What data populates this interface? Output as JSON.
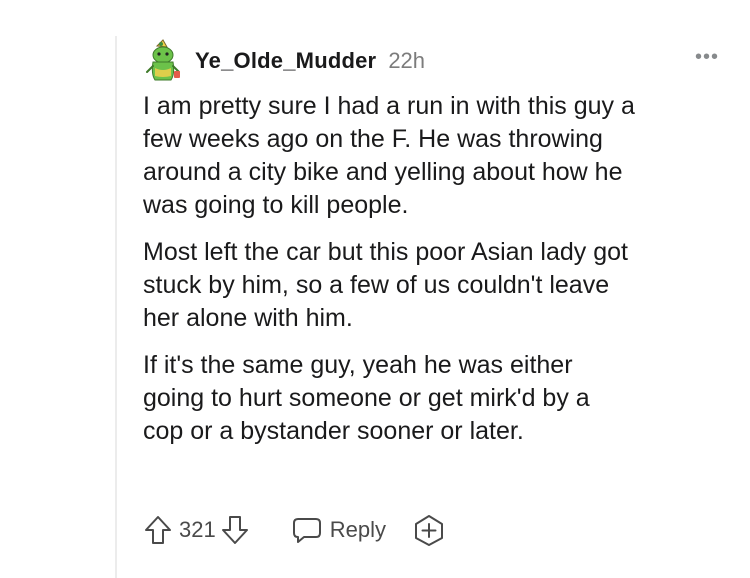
{
  "comment": {
    "username": "Ye_Olde_Mudder",
    "age": "22h",
    "more_label": "•••",
    "paragraphs": [
      "I am pretty sure I had a run in with this guy a\nfew weeks ago on the F. He was throwing\naround a city bike and yelling about how he\nwas going to kill people.",
      "Most left the car but this poor Asian lady got\nstuck by him, so a few of us couldn't leave\nher alone with him.",
      "If it's the same guy, yeah he was either\ngoing to hurt someone or get mirk'd by a\ncop or a bystander sooner or later."
    ]
  },
  "actions": {
    "vote_count": "321",
    "reply_label": "Reply"
  },
  "icons": {
    "avatar": "snoo-avatar-icon",
    "upvote": "upvote-arrow-icon",
    "downvote": "downvote-arrow-icon",
    "reply": "speech-bubble-icon",
    "award": "award-plus-icon",
    "more": "more-options-icon"
  },
  "colors": {
    "text": "#1a1a1b",
    "muted": "#7c7c7c",
    "icon": "#4a4a4a",
    "thread_line": "#ececec",
    "avatar_green": "#6cc24a",
    "avatar_yellow": "#f2d04b"
  }
}
